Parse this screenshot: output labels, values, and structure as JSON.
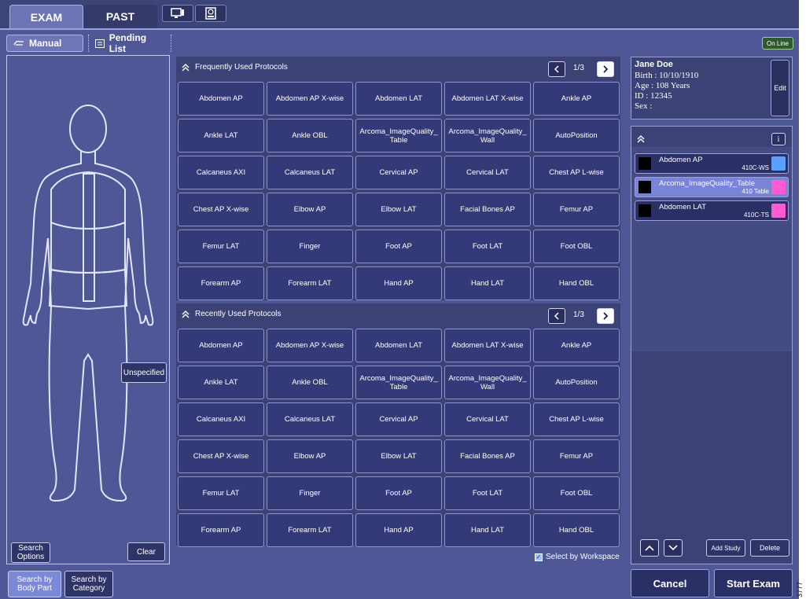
{
  "top_tabs": {
    "exam": "EXAM",
    "past": "PAST"
  },
  "sub_tabs": {
    "manual": "Manual",
    "pending": "Pending List"
  },
  "status": {
    "online": "On Line"
  },
  "left": {
    "unspecified": "Unspecified",
    "search_options": "Search Options",
    "clear": "Clear",
    "search_body_part": "Search by Body Part",
    "search_category": "Search by Category"
  },
  "frequent": {
    "title": "Frequently Used Protocols",
    "page": "1/3",
    "items": [
      "Abdomen AP",
      "Abdomen AP X-wise",
      "Abdomen LAT",
      "Abdomen LAT X-wise",
      "Ankle AP",
      "Ankle LAT",
      "Ankle OBL",
      "Arcoma_ImageQuality_ Table",
      "Arcoma_ImageQuality_ Wall",
      "AutoPosition",
      "Calcaneus AXI",
      "Calcaneus LAT",
      "Cervical AP",
      "Cervical LAT",
      "Chest AP L-wise",
      "Chest AP X-wise",
      "Elbow AP",
      "Elbow LAT",
      "Facial Bones AP",
      "Femur AP",
      "Femur LAT",
      "Finger",
      "Foot AP",
      "Foot LAT",
      "Foot OBL",
      "Forearm AP",
      "Forearm LAT",
      "Hand AP",
      "Hand LAT",
      "Hand OBL"
    ]
  },
  "recent": {
    "title": "Recently Used Protocols",
    "page": "1/3",
    "items": [
      "Abdomen AP",
      "Abdomen AP X-wise",
      "Abdomen LAT",
      "Abdomen LAT X-wise",
      "Ankle AP",
      "Ankle LAT",
      "Ankle OBL",
      "Arcoma_ImageQuality_ Table",
      "Arcoma_ImageQuality_ Wall",
      "AutoPosition",
      "Calcaneus AXI",
      "Calcaneus LAT",
      "Cervical AP",
      "Cervical LAT",
      "Chest AP L-wise",
      "Chest AP X-wise",
      "Elbow AP",
      "Elbow LAT",
      "Facial Bones AP",
      "Femur AP",
      "Femur LAT",
      "Finger",
      "Foot AP",
      "Foot LAT",
      "Foot OBL",
      "Forearm AP",
      "Forearm LAT",
      "Hand AP",
      "Hand LAT",
      "Hand OBL"
    ]
  },
  "select_workspace": "Select by Workspace",
  "patient": {
    "name": "Jane Doe",
    "birth": "Birth : 10/10/1910",
    "age": "Age : 108 Years",
    "id": "ID : 12345",
    "sex": "Sex :",
    "edit": "Edit"
  },
  "study": {
    "info": "i",
    "items": [
      {
        "name": "Abdomen AP",
        "workspace": "410C-WS",
        "badge_color": "#5aa0ff"
      },
      {
        "name": "Arcoma_ImageQuality_Table",
        "workspace": "410 Table",
        "badge_color": "#ff5ad2"
      },
      {
        "name": "Abdomen LAT",
        "workspace": "410C-TS",
        "badge_color": "#ff5ad2"
      }
    ],
    "add_study": "Add Study",
    "delete": "Delete"
  },
  "footer": {
    "cancel": "Cancel",
    "start_exam": "Start Exam"
  },
  "side_label": "3777"
}
